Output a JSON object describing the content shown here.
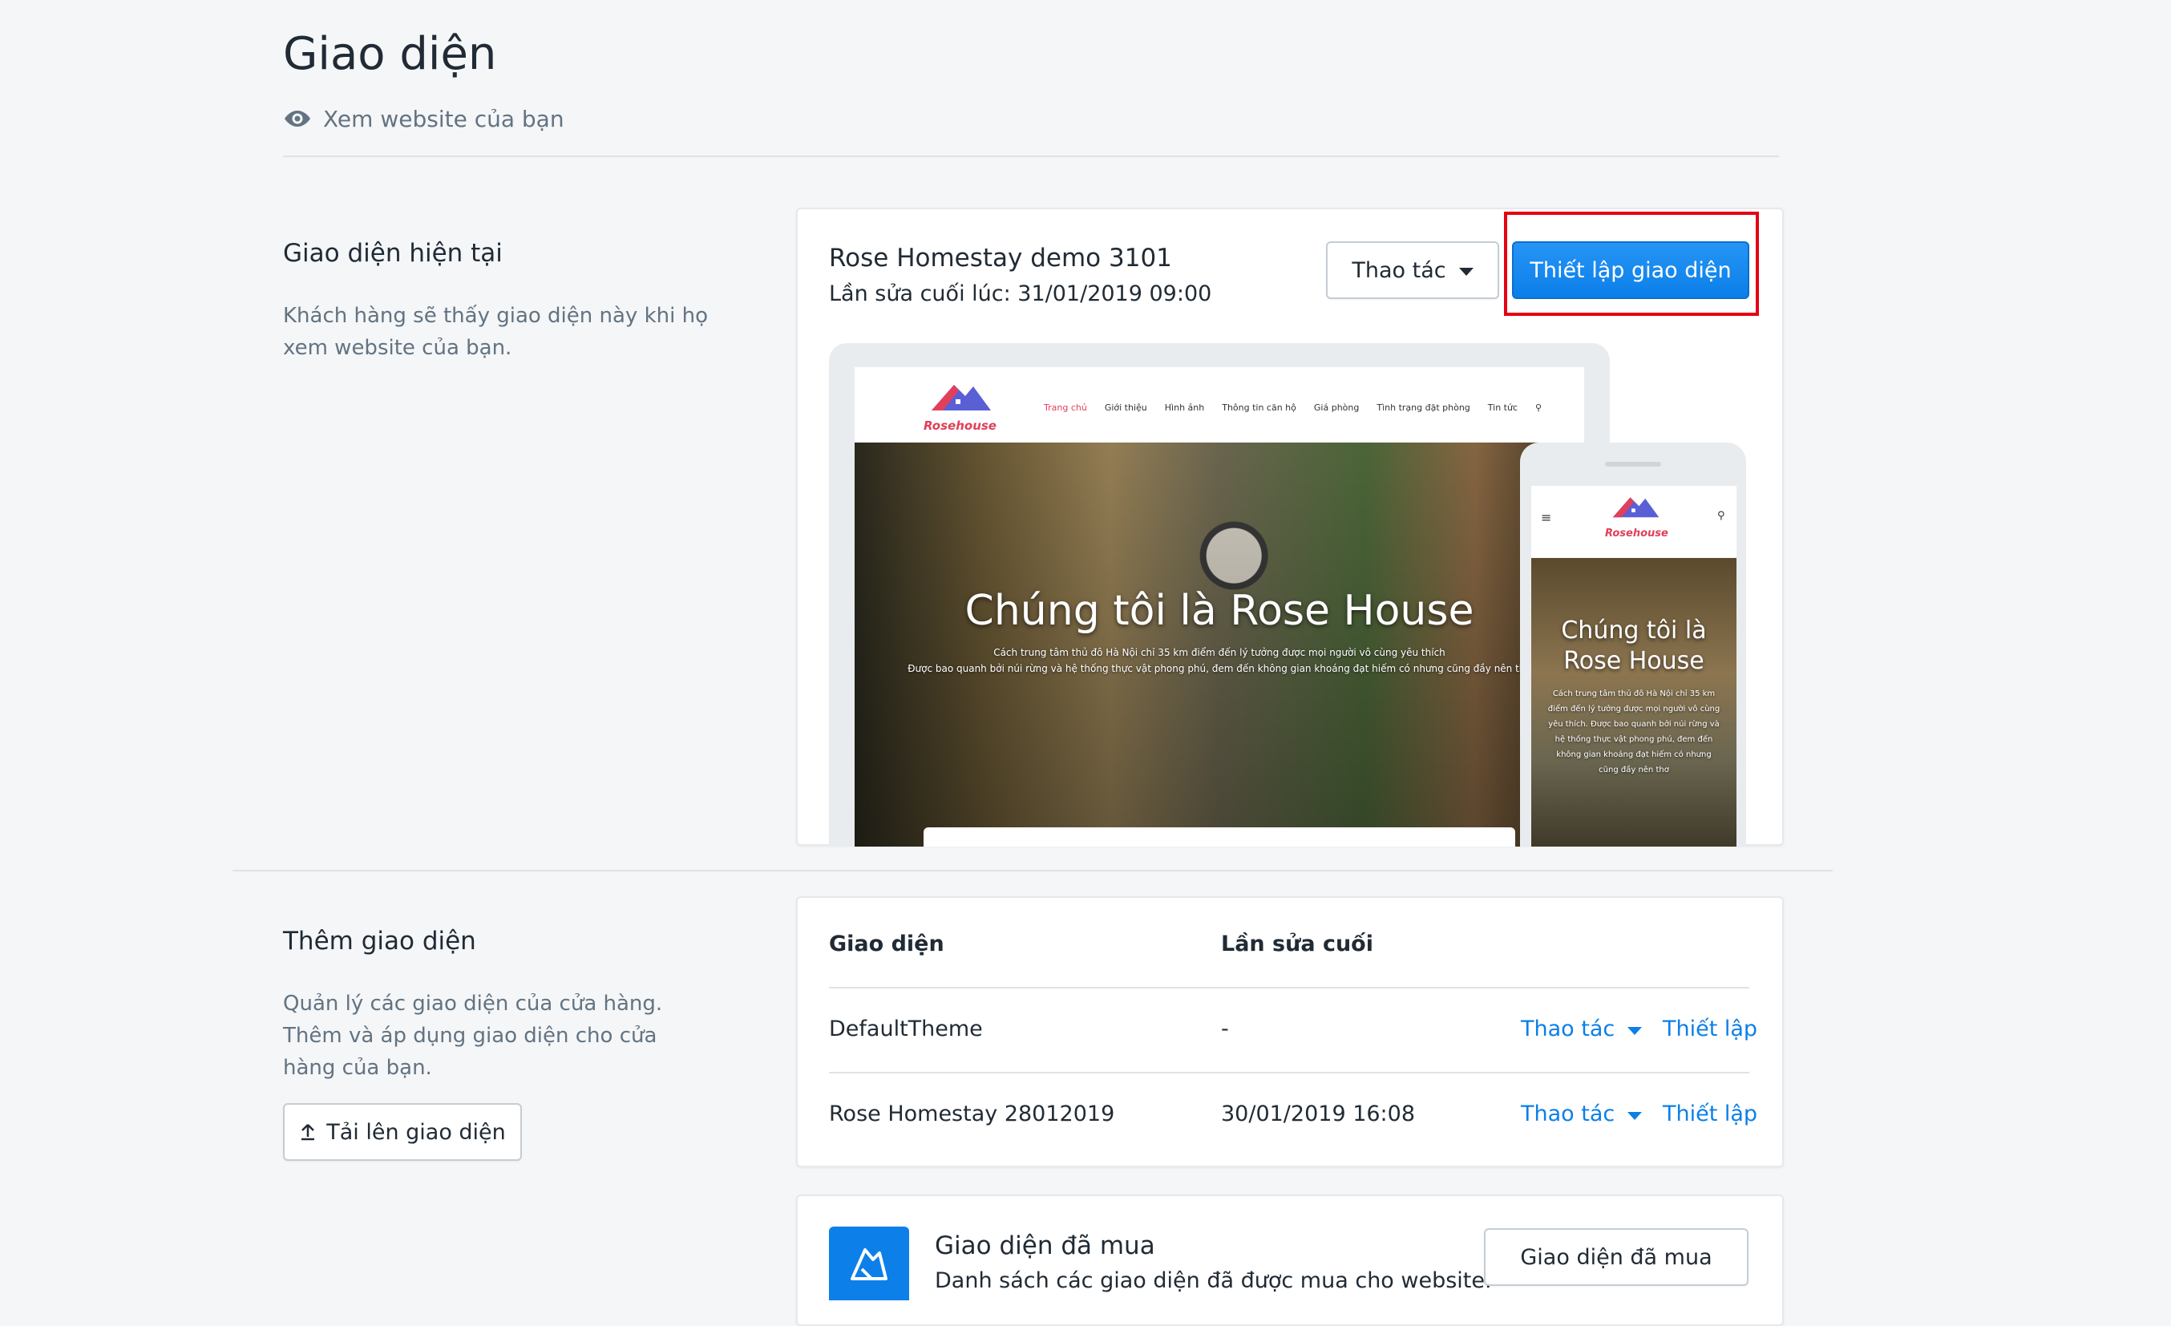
{
  "header": {
    "title": "Giao diện",
    "view_link": "Xem website của bạn"
  },
  "current_theme": {
    "section_title": "Giao diện hiện tại",
    "section_desc": "Khách hàng sẽ thấy giao diện này khi họ xem website của bạn.",
    "name": "Rose Homestay demo 3101",
    "last_modified": "Lần sửa cuối lúc: 31/01/2019 09:00",
    "actions_label": "Thao tác",
    "setup_label": "Thiết lập giao diện",
    "preview": {
      "logo_text": "Rosehouse",
      "nav": [
        "Trang chủ",
        "Giới thiệu",
        "Hình ảnh",
        "Thông tin căn hộ",
        "Giá phòng",
        "Tình trạng đặt phòng",
        "Tin tức"
      ],
      "hero_title": "Chúng tôi là Rose House",
      "hero_sub_1": "Cách trung tâm thủ đô Hà Nội chỉ 35 km điểm đến lý tưởng được mọi người vô cùng yêu thích",
      "hero_sub_2": "Được bao quanh bởi núi rừng và hệ thống thực vật phong phú, đem đến không gian khoáng đạt hiếm có nhưng cũng đầy nên thơ",
      "mobile_title": "Chúng tôi là Rose House",
      "mobile_sub": "Cách trung tâm thủ đô Hà Nội chỉ 35 km điểm đến lý tưởng được mọi người vô cùng yêu thích. Được bao quanh bởi núi rừng và hệ thống thực vật phong phú, đem đến không gian khoáng đạt hiếm có nhưng cũng đầy nên thơ"
    }
  },
  "add_theme": {
    "section_title": "Thêm giao diện",
    "section_desc": "Quản lý các giao diện của cửa hàng. Thêm và áp dụng giao diện cho cửa hàng của bạn.",
    "upload_label": "Tải lên giao diện",
    "table": {
      "col_theme": "Giao diện",
      "col_modified": "Lần sửa cuối",
      "rows": [
        {
          "name": "DefaultTheme",
          "modified": "-",
          "actions": "Thao tác",
          "setup": "Thiết lập"
        },
        {
          "name": "Rose Homestay 28012019",
          "modified": "30/01/2019 16:08",
          "actions": "Thao tác",
          "setup": "Thiết lập"
        }
      ]
    }
  },
  "purchased": {
    "title": "Giao diện đã mua",
    "desc": "Danh sách các giao diện đã được mua cho website.",
    "button_label": "Giao diện đã mua"
  },
  "colors": {
    "primary": "#0c7fe8",
    "highlight": "#e60012",
    "text": "#212b35",
    "subdued": "#637381"
  }
}
